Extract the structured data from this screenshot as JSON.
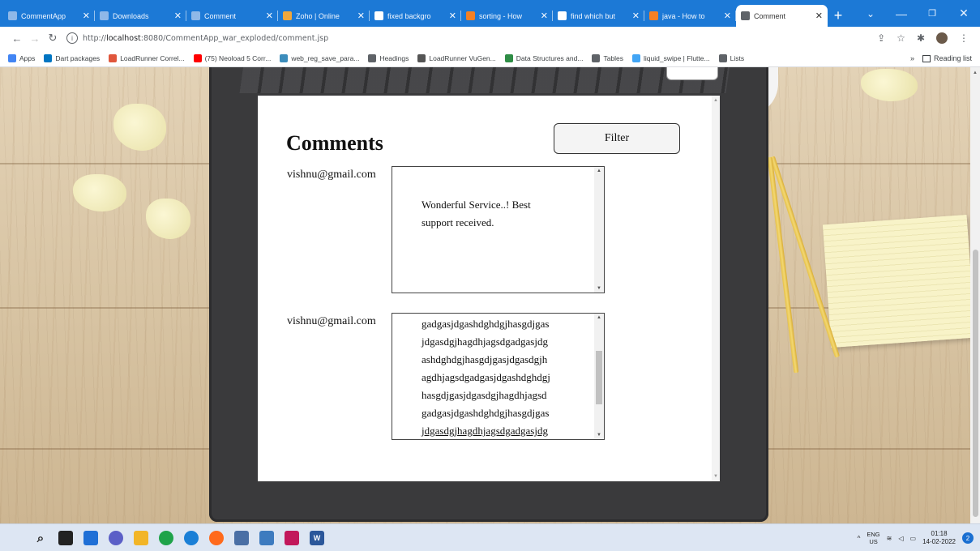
{
  "browser": {
    "tabs": [
      {
        "label": "CommentApp",
        "icon": "blank-page-icon",
        "color": "#8fb8e8"
      },
      {
        "label": "Downloads",
        "icon": "blank-page-icon",
        "color": "#8fb8e8"
      },
      {
        "label": "Comment",
        "icon": "blank-page-icon",
        "color": "#8fb8e8"
      },
      {
        "label": "Zoho | Online",
        "icon": "zoho-mail-icon",
        "color": "#f0a73c"
      },
      {
        "label": "fixed backgro",
        "icon": "google-icon",
        "color": "#ffffff"
      },
      {
        "label": "sorting - How",
        "icon": "stackoverflow-icon",
        "color": "#f48024"
      },
      {
        "label": "find which but",
        "icon": "google-icon",
        "color": "#ffffff"
      },
      {
        "label": "java - How to",
        "icon": "stackoverflow-icon",
        "color": "#f48024"
      },
      {
        "label": "Comment",
        "icon": "globe-icon",
        "color": "#5f6368",
        "active": true
      }
    ],
    "new_tab": "+",
    "url_prefix": "http://",
    "url_host": "localhost",
    "url_rest": ":8080/CommentApp_war_exploded/comment.jsp"
  },
  "bookmarks": [
    {
      "label": "Apps",
      "icon": "apps-grid-icon",
      "color": "#4285f4"
    },
    {
      "label": "Dart packages",
      "icon": "dart-icon",
      "color": "#0175c2"
    },
    {
      "label": "LoadRunner Correl...",
      "icon": "jds-icon",
      "color": "#e0563c"
    },
    {
      "label": "(75) Neoload 5 Corr...",
      "icon": "youtube-icon",
      "color": "#ff0000"
    },
    {
      "label": "web_reg_save_para...",
      "icon": "web-icon",
      "color": "#3c8dbc"
    },
    {
      "label": "Headings",
      "icon": "globe-icon",
      "color": "#5f6368"
    },
    {
      "label": "LoadRunner VuGen...",
      "icon": "loadrunner-icon",
      "color": "#555555"
    },
    {
      "label": "Data Structures and...",
      "icon": "gg-icon",
      "color": "#2f8d46"
    },
    {
      "label": "Tables",
      "icon": "globe-icon",
      "color": "#5f6368"
    },
    {
      "label": "liquid_swipe | Flutte...",
      "icon": "flutter-icon",
      "color": "#42a5f5"
    },
    {
      "label": "Lists",
      "icon": "globe-icon",
      "color": "#5f6368"
    }
  ],
  "bookmarks_more": "»",
  "reading_list": "Reading list",
  "page": {
    "heading": "Comments",
    "filter_label": "Filter",
    "comments": [
      {
        "email": "vishnu@gmail.com",
        "lines": [
          "Wonderful Service..! Best",
          "support received."
        ]
      },
      {
        "email": "vishnu@gmail.com",
        "lines": [
          "gadgasjdgashdghdgjhasgdjgas",
          "jdgasdgjhagdhjagsdgadgasjdg",
          "ashdghdgjhasgdjgasjdgasdgjh",
          "agdhjagsdgadgasjdgashdghdgj",
          "hasgdjgasjdgasdgjhagdhjagsd",
          "gadgasjdgashdghdgjhasgdjgas",
          "jdgasdgjhagdhjagsdgadgasjdg"
        ]
      }
    ]
  },
  "taskbar": {
    "lang_top": "ENG",
    "lang_bottom": "US",
    "time": "01:18",
    "date": "14-02-2022",
    "notification_count": "2"
  }
}
